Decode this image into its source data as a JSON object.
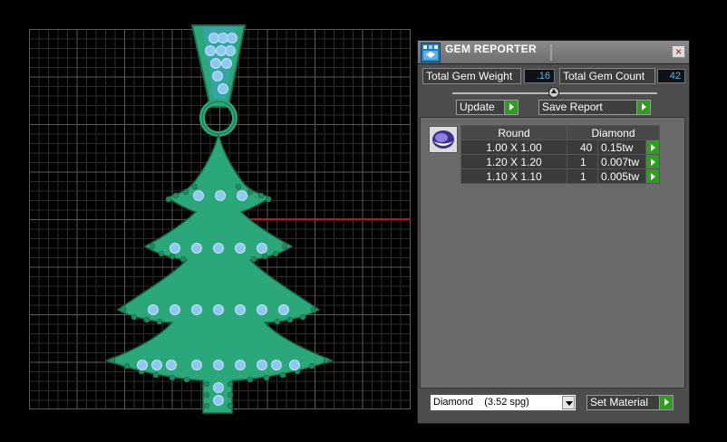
{
  "panel": {
    "title": "GEM REPORTER",
    "close_label": "×",
    "total_weight_label": "Total Gem Weight",
    "total_weight_value": ".16",
    "total_count_label": "Total Gem Count",
    "total_count_value": "42",
    "update_label": "Update",
    "save_report_label": "Save Report",
    "table": {
      "header": [
        "Round",
        "Diamond"
      ],
      "rows": [
        {
          "size": "1.00 X 1.00",
          "qty": "40",
          "weight": "0.15tw"
        },
        {
          "size": "1.20 X 1.20",
          "qty": "1",
          "weight": "0.007tw"
        },
        {
          "size": "1.10 X 1.10",
          "qty": "1",
          "weight": "0.005tw"
        }
      ]
    },
    "material_value": "Diamond    (3.52 spg)",
    "set_material_label": "Set Material"
  },
  "viewport": {
    "model": "christmas-tree-pendant",
    "model_color": "#2aa87a",
    "gem_color": "#8fc8f0",
    "guide_line_color": "#c11"
  },
  "icons": {
    "app": "gem-reporter-icon",
    "close": "close-icon",
    "gem_shape": "round-gem-icon",
    "play": "play-arrow-icon"
  }
}
